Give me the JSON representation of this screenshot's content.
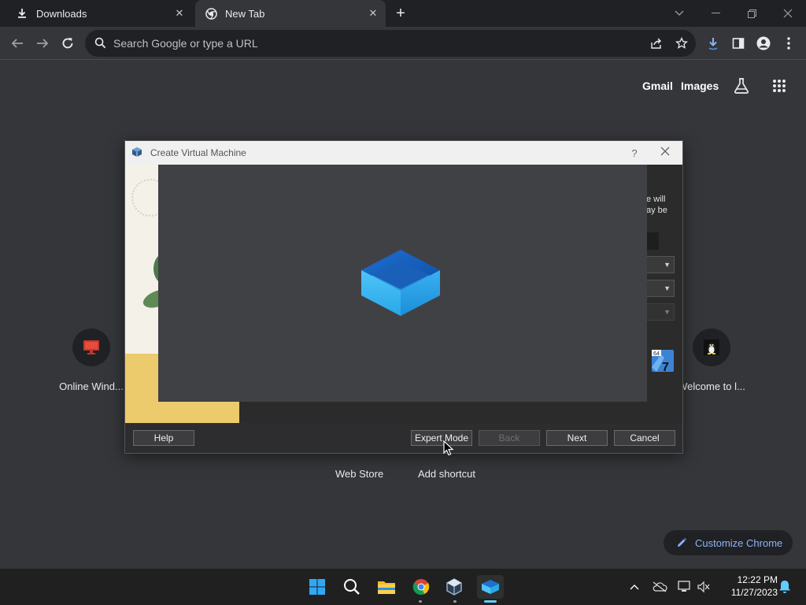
{
  "tabs": [
    {
      "title": "Downloads",
      "icon": "download-icon"
    },
    {
      "title": "New Tab",
      "icon": "chrome-icon"
    }
  ],
  "omnibox": {
    "placeholder": "Search Google or type a URL"
  },
  "ntp": {
    "gmail": "Gmail",
    "images": "Images",
    "shortcuts": [
      {
        "label": "Online Wind...",
        "icon": "monitor-icon"
      },
      {
        "label": "Welcome to l...",
        "icon": "penguin-icon"
      }
    ],
    "web_store": "Web Store",
    "add_shortcut": "Add shortcut",
    "customize": "Customize Chrome"
  },
  "dialog": {
    "title": "Create Virtual Machine",
    "help_glyph": "?",
    "partial_text_1": "e will",
    "partial_text_2": "ay be",
    "os_badge": "64",
    "os_version": "7",
    "buttons": {
      "help": "Help",
      "expert_mode": "Expert Mode",
      "back": "Back",
      "next": "Next",
      "cancel": "Cancel"
    }
  },
  "taskbar": {
    "time": "12:22 PM",
    "date": "11/27/2023"
  },
  "colors": {
    "accent_link": "#8ab4f8",
    "chrome_bg": "#35363a",
    "tabstrip_bg": "#202124",
    "check_green": "#5bd21c",
    "splash_bg": "#404145"
  }
}
